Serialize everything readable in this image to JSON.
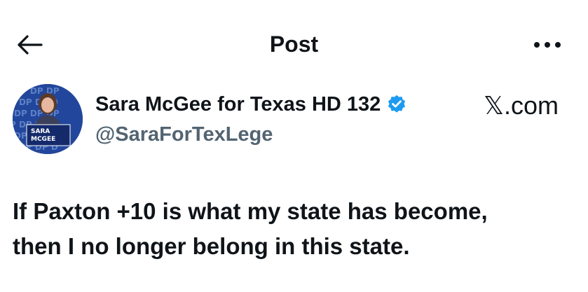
{
  "header": {
    "title": "Post",
    "back_icon": "arrow-left-icon",
    "more_icon": "more-horizontal-icon"
  },
  "author": {
    "display_name": "Sara McGee for Texas HD 132",
    "verified_icon": "verified-badge-icon",
    "verified_color": "#1d9bf0",
    "handle": "@SaraForTexLege",
    "avatar_sign_line1": "SARA",
    "avatar_sign_line2": "MCGEE"
  },
  "watermark": "𝕏.com",
  "post": {
    "lines": [
      "If Paxton +10 is what my state has become,",
      "then I no longer belong in this state."
    ]
  },
  "colors": {
    "text_primary": "#0f1419",
    "text_secondary": "#536471",
    "accent": "#1d9bf0"
  }
}
